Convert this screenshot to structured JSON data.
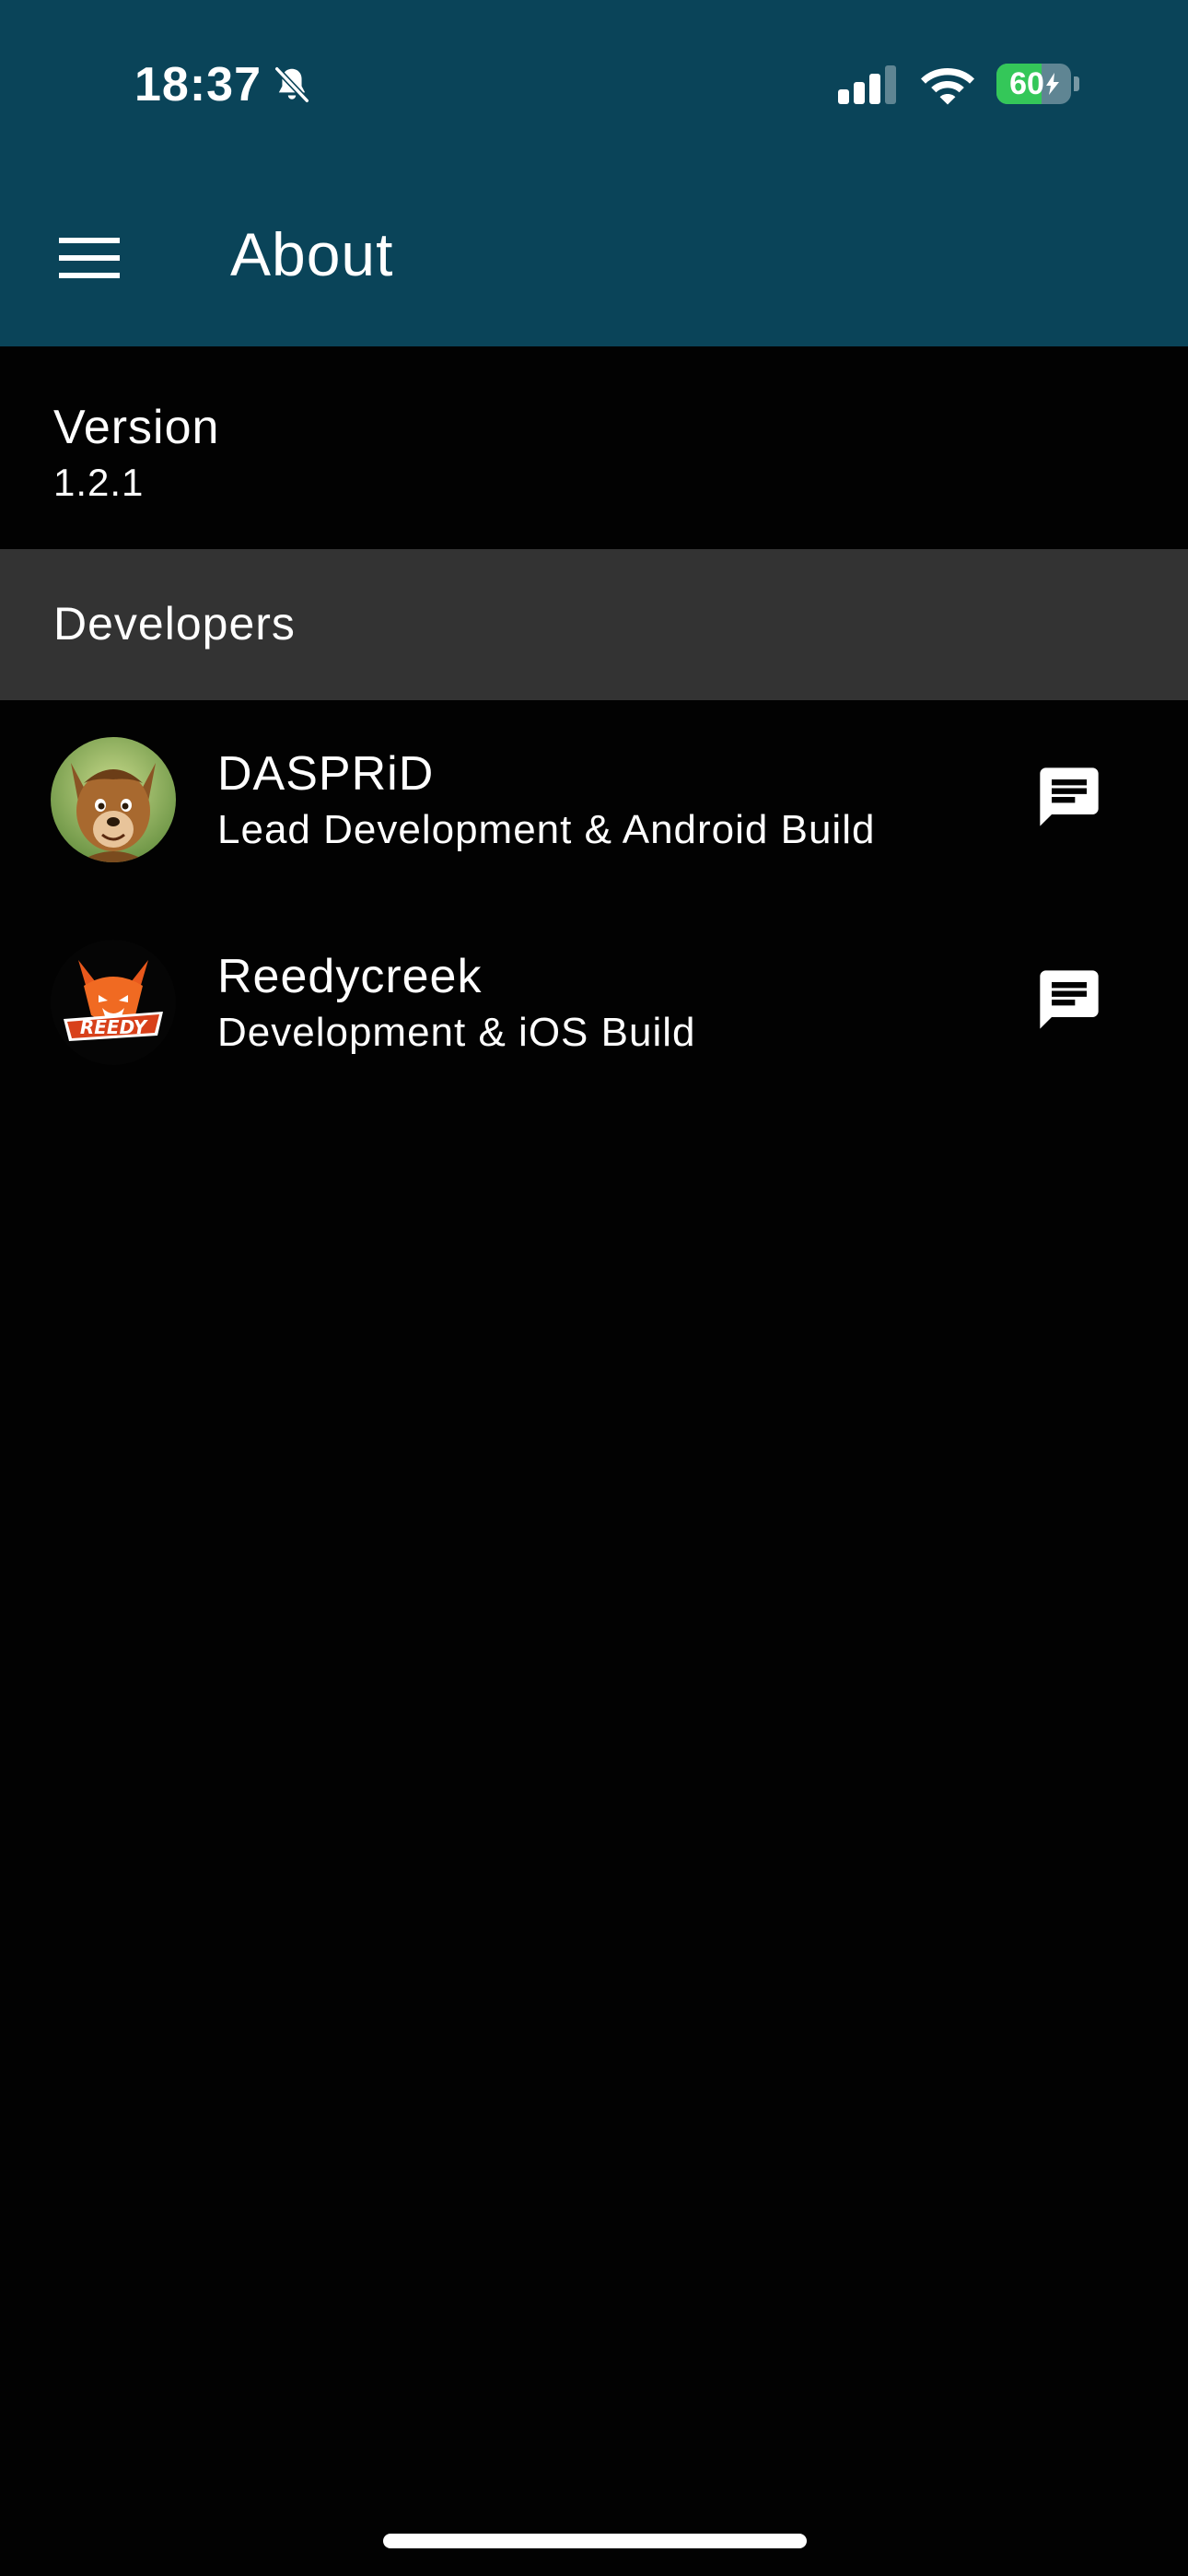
{
  "status_bar": {
    "time": "18:37",
    "battery_percent": "60",
    "battery_level": 0.6
  },
  "app_bar": {
    "title": "About"
  },
  "version": {
    "label": "Version",
    "value": "1.2.1"
  },
  "developers_section": {
    "label": "Developers",
    "items": [
      {
        "name": "DASPRiD",
        "role": "Lead Development & Android Build"
      },
      {
        "name": "Reedycreek",
        "role": "Development & iOS Build"
      }
    ]
  },
  "colors": {
    "app_bar": "#0a4459",
    "background": "#020202",
    "section_header": "#333333",
    "battery_fill": "#34c759"
  },
  "icons": {
    "menu": "hamburger-menu-icon",
    "message": "message-icon",
    "bell": "bell-slash-icon",
    "signal": "cellular-signal-icon",
    "wifi": "wifi-icon",
    "battery": "battery-charging-icon"
  }
}
